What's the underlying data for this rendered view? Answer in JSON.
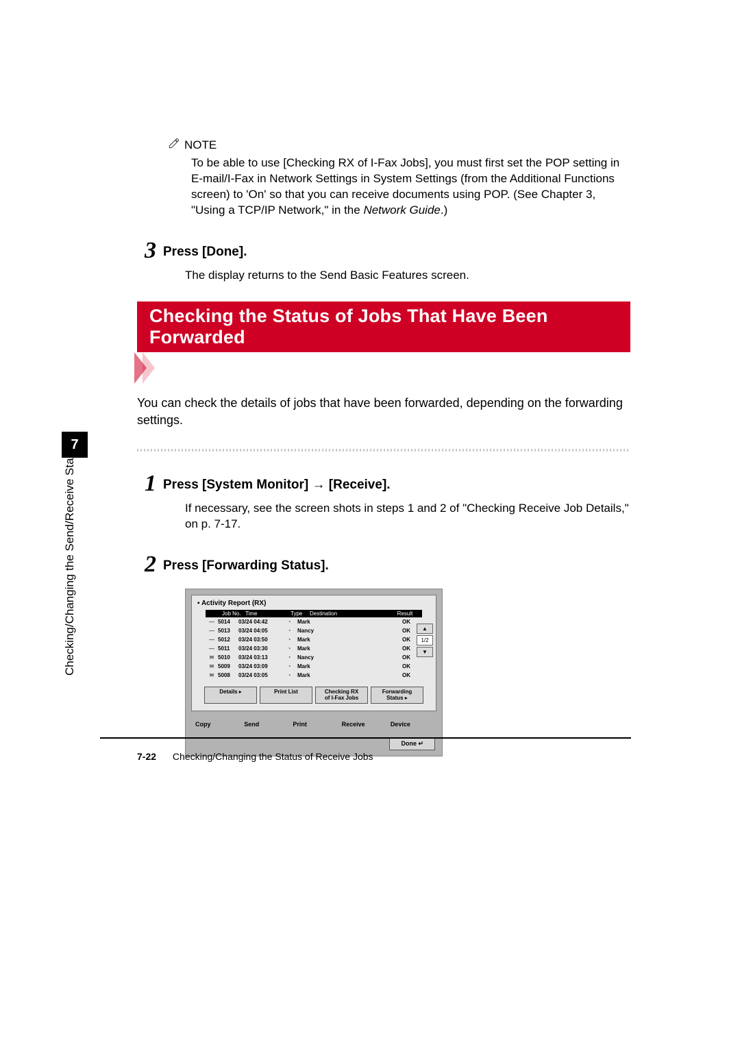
{
  "note": {
    "label": "NOTE",
    "body_prefix": "To be able to use [Checking RX of I-Fax Jobs], you must first set the POP setting in E-mail/I-Fax in Network Settings in System Settings (from the Additional Functions screen) to 'On' so that you can receive documents using POP. (See Chapter 3, \"Using a TCP/IP Network,\" in the ",
    "body_italic": "Network Guide",
    "body_suffix": ".)"
  },
  "step3": {
    "num": "3",
    "title": "Press [Done].",
    "body": "The display returns to the Send Basic Features screen."
  },
  "banner": "Checking the Status of Jobs That Have Been Forwarded",
  "intro": "You can check the details of jobs that have been forwarded, depending on the forwarding settings.",
  "step1": {
    "num": "1",
    "title": "Press [System Monitor] → [Receive].",
    "body": "If necessary, see the screen shots in steps 1 and 2 of \"Checking Receive Job Details,\" on p. 7-17."
  },
  "step2": {
    "num": "2",
    "title": "Press [Forwarding Status]."
  },
  "shot": {
    "title": "▪ Activity Report (RX)",
    "headers": {
      "job": "Job No.",
      "time": "Time",
      "type": "Type",
      "dest": "Destination",
      "result": "Result"
    },
    "rows": [
      {
        "icon": "—",
        "job": "5014",
        "time": "03/24 04:42",
        "dest": "Mark",
        "result": "OK"
      },
      {
        "icon": "—",
        "job": "5013",
        "time": "03/24 04:05",
        "dest": "Nancy",
        "result": "OK"
      },
      {
        "icon": "—",
        "job": "5012",
        "time": "03/24 03:50",
        "dest": "Mark",
        "result": "OK"
      },
      {
        "icon": "—",
        "job": "5011",
        "time": "03/24 03:30",
        "dest": "Mark",
        "result": "OK"
      },
      {
        "icon": "✉",
        "job": "5010",
        "time": "03/24 03:13",
        "dest": "Nancy",
        "result": "OK"
      },
      {
        "icon": "✉",
        "job": "5009",
        "time": "03/24 03:09",
        "dest": "Mark",
        "result": "OK"
      },
      {
        "icon": "✉",
        "job": "5008",
        "time": "03/24 03:05",
        "dest": "Mark",
        "result": "OK"
      }
    ],
    "pager": {
      "up": "▲",
      "label": "1/2",
      "down": "▼"
    },
    "buttons": {
      "details": "Details",
      "print": "Print List",
      "check": "Checking RX\nof I-Fax Jobs",
      "fwd": "Forwarding\nStatus"
    },
    "tabs": {
      "copy": "Copy",
      "send": "Send",
      "print": "Print",
      "receive": "Receive",
      "device": "Device"
    },
    "done": "Done"
  },
  "left": {
    "chapter": "7",
    "vtext": "Checking/Changing the Send/Receive Status"
  },
  "footer": {
    "page": "7-22",
    "title": "Checking/Changing the Status of Receive Jobs"
  }
}
